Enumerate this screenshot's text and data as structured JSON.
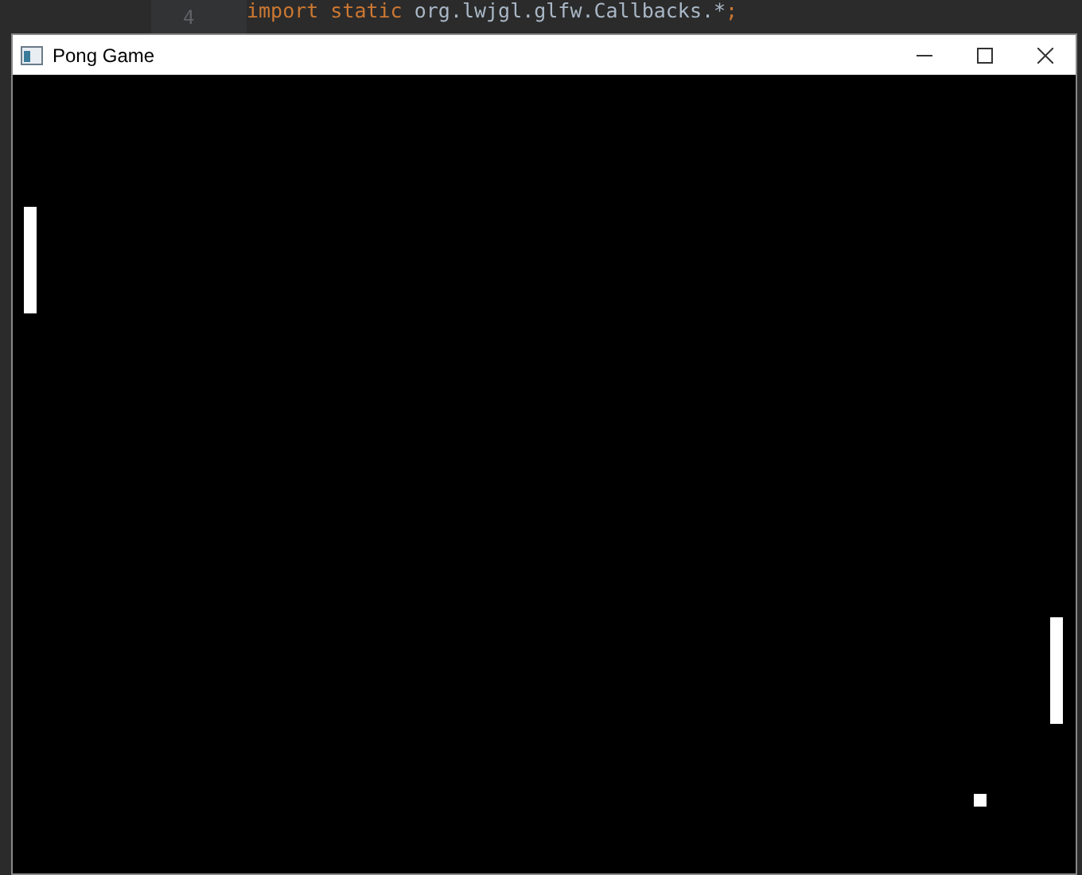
{
  "editor": {
    "line_number": "4",
    "tokens": [
      {
        "text": "import static",
        "kind": "keyword"
      },
      {
        "text": " org.lwjgl.glfw.Callbacks.*",
        "kind": "plain"
      },
      {
        "text": ";",
        "kind": "keyword"
      }
    ]
  },
  "window": {
    "title": "Pong Game"
  }
}
